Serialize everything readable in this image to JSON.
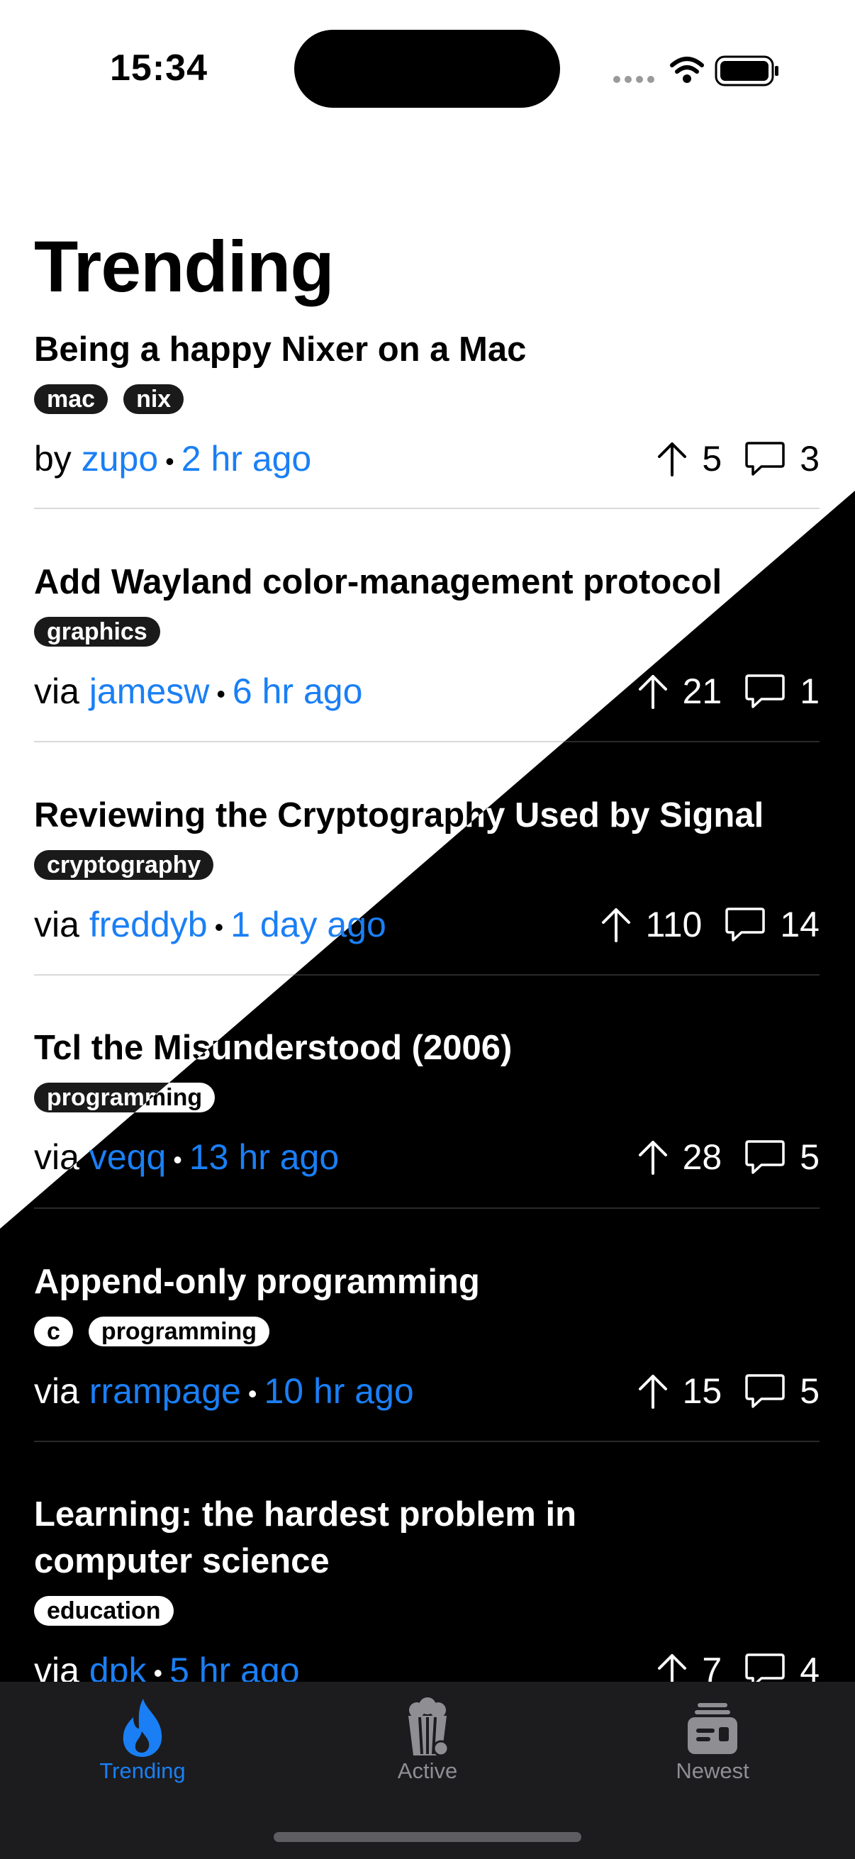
{
  "status": {
    "time": "15:34"
  },
  "page": {
    "title": "Trending"
  },
  "stories": [
    {
      "title": "Being a happy Nixer on a Mac",
      "tags": [
        "mac",
        "nix"
      ],
      "prefix": "by",
      "user": "zupo",
      "time": "2 hr ago",
      "votes": "5",
      "comments": "3"
    },
    {
      "title": "Add Wayland color-management protocol",
      "tags": [
        "graphics"
      ],
      "prefix": "via",
      "user": "jamesw",
      "time": "6 hr ago",
      "votes": "21",
      "comments": "1"
    },
    {
      "title": "Reviewing the Cryptography Used by Signal",
      "tags": [
        "cryptography"
      ],
      "prefix": "via",
      "user": "freddyb",
      "time": "1 day ago",
      "votes": "110",
      "comments": "14"
    },
    {
      "title": "Tcl the Misunderstood (2006)",
      "tags": [
        "programming"
      ],
      "prefix": "via",
      "user": "veqq",
      "time": "13 hr ago",
      "votes": "28",
      "comments": "5"
    },
    {
      "title": "Append-only programming",
      "tags": [
        "c",
        "programming"
      ],
      "prefix": "via",
      "user": "rrampage",
      "time": "10 hr ago",
      "votes": "15",
      "comments": "5"
    },
    {
      "title": "Learning: the hardest problem in computer science",
      "tags": [
        "education"
      ],
      "prefix": "via",
      "user": "dpk",
      "time": "5 hr ago",
      "votes": "7",
      "comments": "4"
    }
  ],
  "tabs": [
    {
      "label": "Trending",
      "icon": "flame-icon",
      "active": true
    },
    {
      "label": "Active",
      "icon": "popcorn-icon",
      "active": false
    },
    {
      "label": "Newest",
      "icon": "newspaper-icon",
      "active": false
    }
  ],
  "colors": {
    "link": "#1a7ff5",
    "tab_active": "#1a7ff5",
    "tab_inactive": "#8e8e93",
    "tab_bar": "#1c1c1e"
  }
}
